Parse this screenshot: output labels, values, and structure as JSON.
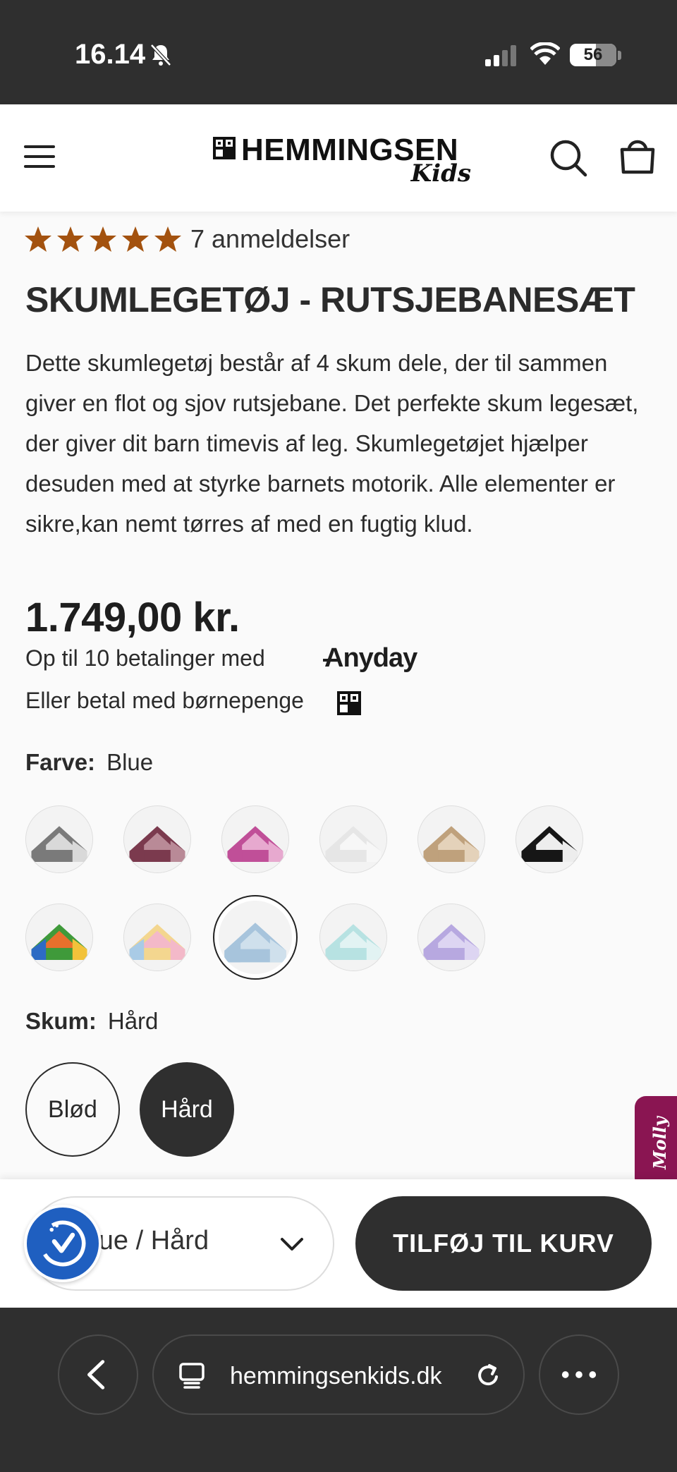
{
  "status": {
    "time": "16.14",
    "battery": "56",
    "battery_level": 0.56
  },
  "header": {
    "logo_main": "HEMMINGSEN",
    "logo_sub": "Kids"
  },
  "product": {
    "rating_stars": 5,
    "review_count": "7 anmeldelser",
    "title": "SKUMLEGETØJ - RUTSJEBANESÆT",
    "description": "Dette skumlegetøj består af 4 skum dele, der til sammen giver en flot og sjov rutsjebane. Det perfekte skum legesæt, der giver dit barn timevis af leg. Skumlegetøjet hjælper desuden med at styrke barnets motorik. Alle elementer er sikre,kan nemt tørres af med en fugtig klud.",
    "price": "1.749,00 kr.",
    "installments_text": "Op til 10 betalinger med",
    "installments_brand": "Anyday",
    "childbenefit_text": "Eller betal med børnepenge"
  },
  "color_option": {
    "label": "Farve:",
    "value": "Blue",
    "swatches": [
      {
        "name": "grey-white",
        "colors": [
          "#7a7a7a",
          "#d9d9d9"
        ]
      },
      {
        "name": "bordeaux",
        "colors": [
          "#7b3a4e",
          "#b98a97"
        ]
      },
      {
        "name": "pink",
        "colors": [
          "#c04f98",
          "#e7a9cf"
        ]
      },
      {
        "name": "white",
        "colors": [
          "#e6e6e6",
          "#f7f7f7"
        ]
      },
      {
        "name": "beige",
        "colors": [
          "#bfa17c",
          "#e4d2ba"
        ]
      },
      {
        "name": "black",
        "colors": [
          "#161616",
          "#ededed"
        ]
      },
      {
        "name": "multicolor",
        "colors": [
          "#3f9a3a",
          "#e8702c",
          "#2d6bc4",
          "#f2c23a"
        ]
      },
      {
        "name": "pastel",
        "colors": [
          "#f3d68f",
          "#f3b9c9",
          "#a9cbe6"
        ]
      },
      {
        "name": "blue",
        "colors": [
          "#a7c4dc",
          "#cfe0ec"
        ],
        "selected": true
      },
      {
        "name": "mint",
        "colors": [
          "#b7e2e2",
          "#e2f3f3"
        ]
      },
      {
        "name": "lavender",
        "colors": [
          "#b7a8e0",
          "#ddd5f2"
        ]
      }
    ]
  },
  "foam_option": {
    "label": "Skum:",
    "value": "Hård",
    "choices": [
      "Blød",
      "Hård"
    ]
  },
  "molly_tab": "Molly",
  "cart_bar": {
    "variant_value": "Blue / Hård",
    "add_to_cart": "TILFØJ TIL KURV"
  },
  "browser": {
    "url": "hemmingsenkids.dk"
  },
  "colors": {
    "dark": "#2f2f2f",
    "star": "#a3520f",
    "badge": "#1f5fc0",
    "molly": "#8a1552"
  }
}
